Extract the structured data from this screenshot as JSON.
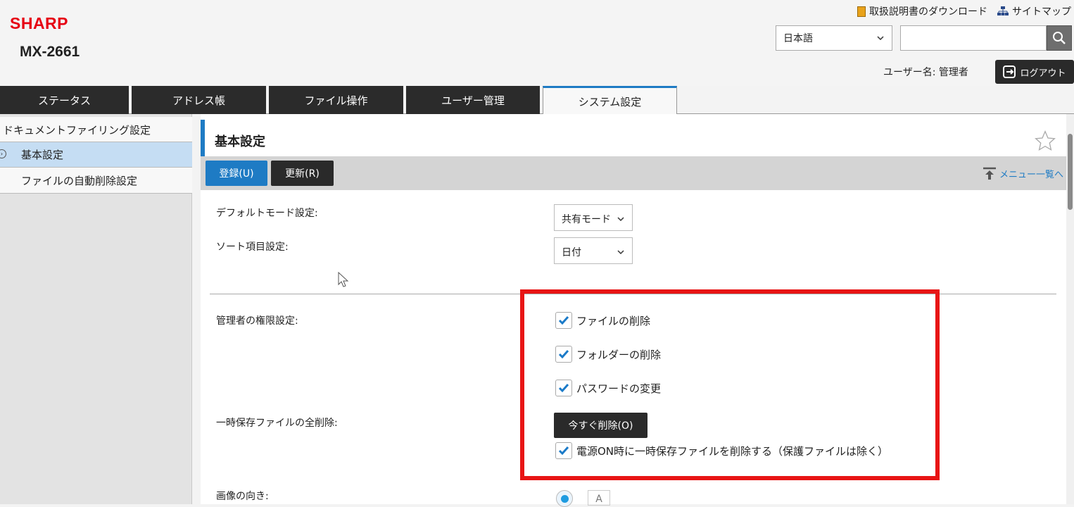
{
  "header": {
    "logo": "SHARP",
    "model": "MX-2661",
    "manual_link": "取扱説明書のダウンロード",
    "sitemap_link": "サイトマップ",
    "language": "日本語",
    "search_placeholder": "",
    "username": "ユーザー名: 管理者",
    "logout": "ログアウト"
  },
  "tabs": [
    "ステータス",
    "アドレス帳",
    "ファイル操作",
    "ユーザー管理",
    "システム設定"
  ],
  "sidebar": {
    "category": "ドキュメントファイリング設定",
    "items": [
      "基本設定",
      "ファイルの自動削除設定"
    ]
  },
  "page": {
    "title": "基本設定",
    "register_button": "登録(U)",
    "update_button": "更新(R)",
    "menu_back": "メニュー一覧へ"
  },
  "form": {
    "default_mode_label": "デフォルトモード設定:",
    "default_mode_value": "共有モード",
    "sort_label": "ソート項目設定:",
    "sort_value": "日付",
    "admin_label": "管理者の権限設定:",
    "admin_options": [
      {
        "label": "ファイルの削除",
        "checked": true
      },
      {
        "label": "フォルダーの削除",
        "checked": true
      },
      {
        "label": "パスワードの変更",
        "checked": true
      }
    ],
    "temp_label": "一時保存ファイルの全削除:",
    "delete_now_button": "今すぐ削除(O)",
    "power_on_delete": {
      "label": "電源ON時に一時保存ファイルを削除する（保護ファイルは除く）",
      "checked": true
    },
    "orientation_label": "画像の向き:",
    "orientation_icon": "A"
  },
  "colors": {
    "accent": "#1e7bc4",
    "brand": "#e60012",
    "highlight": "#e81515"
  }
}
